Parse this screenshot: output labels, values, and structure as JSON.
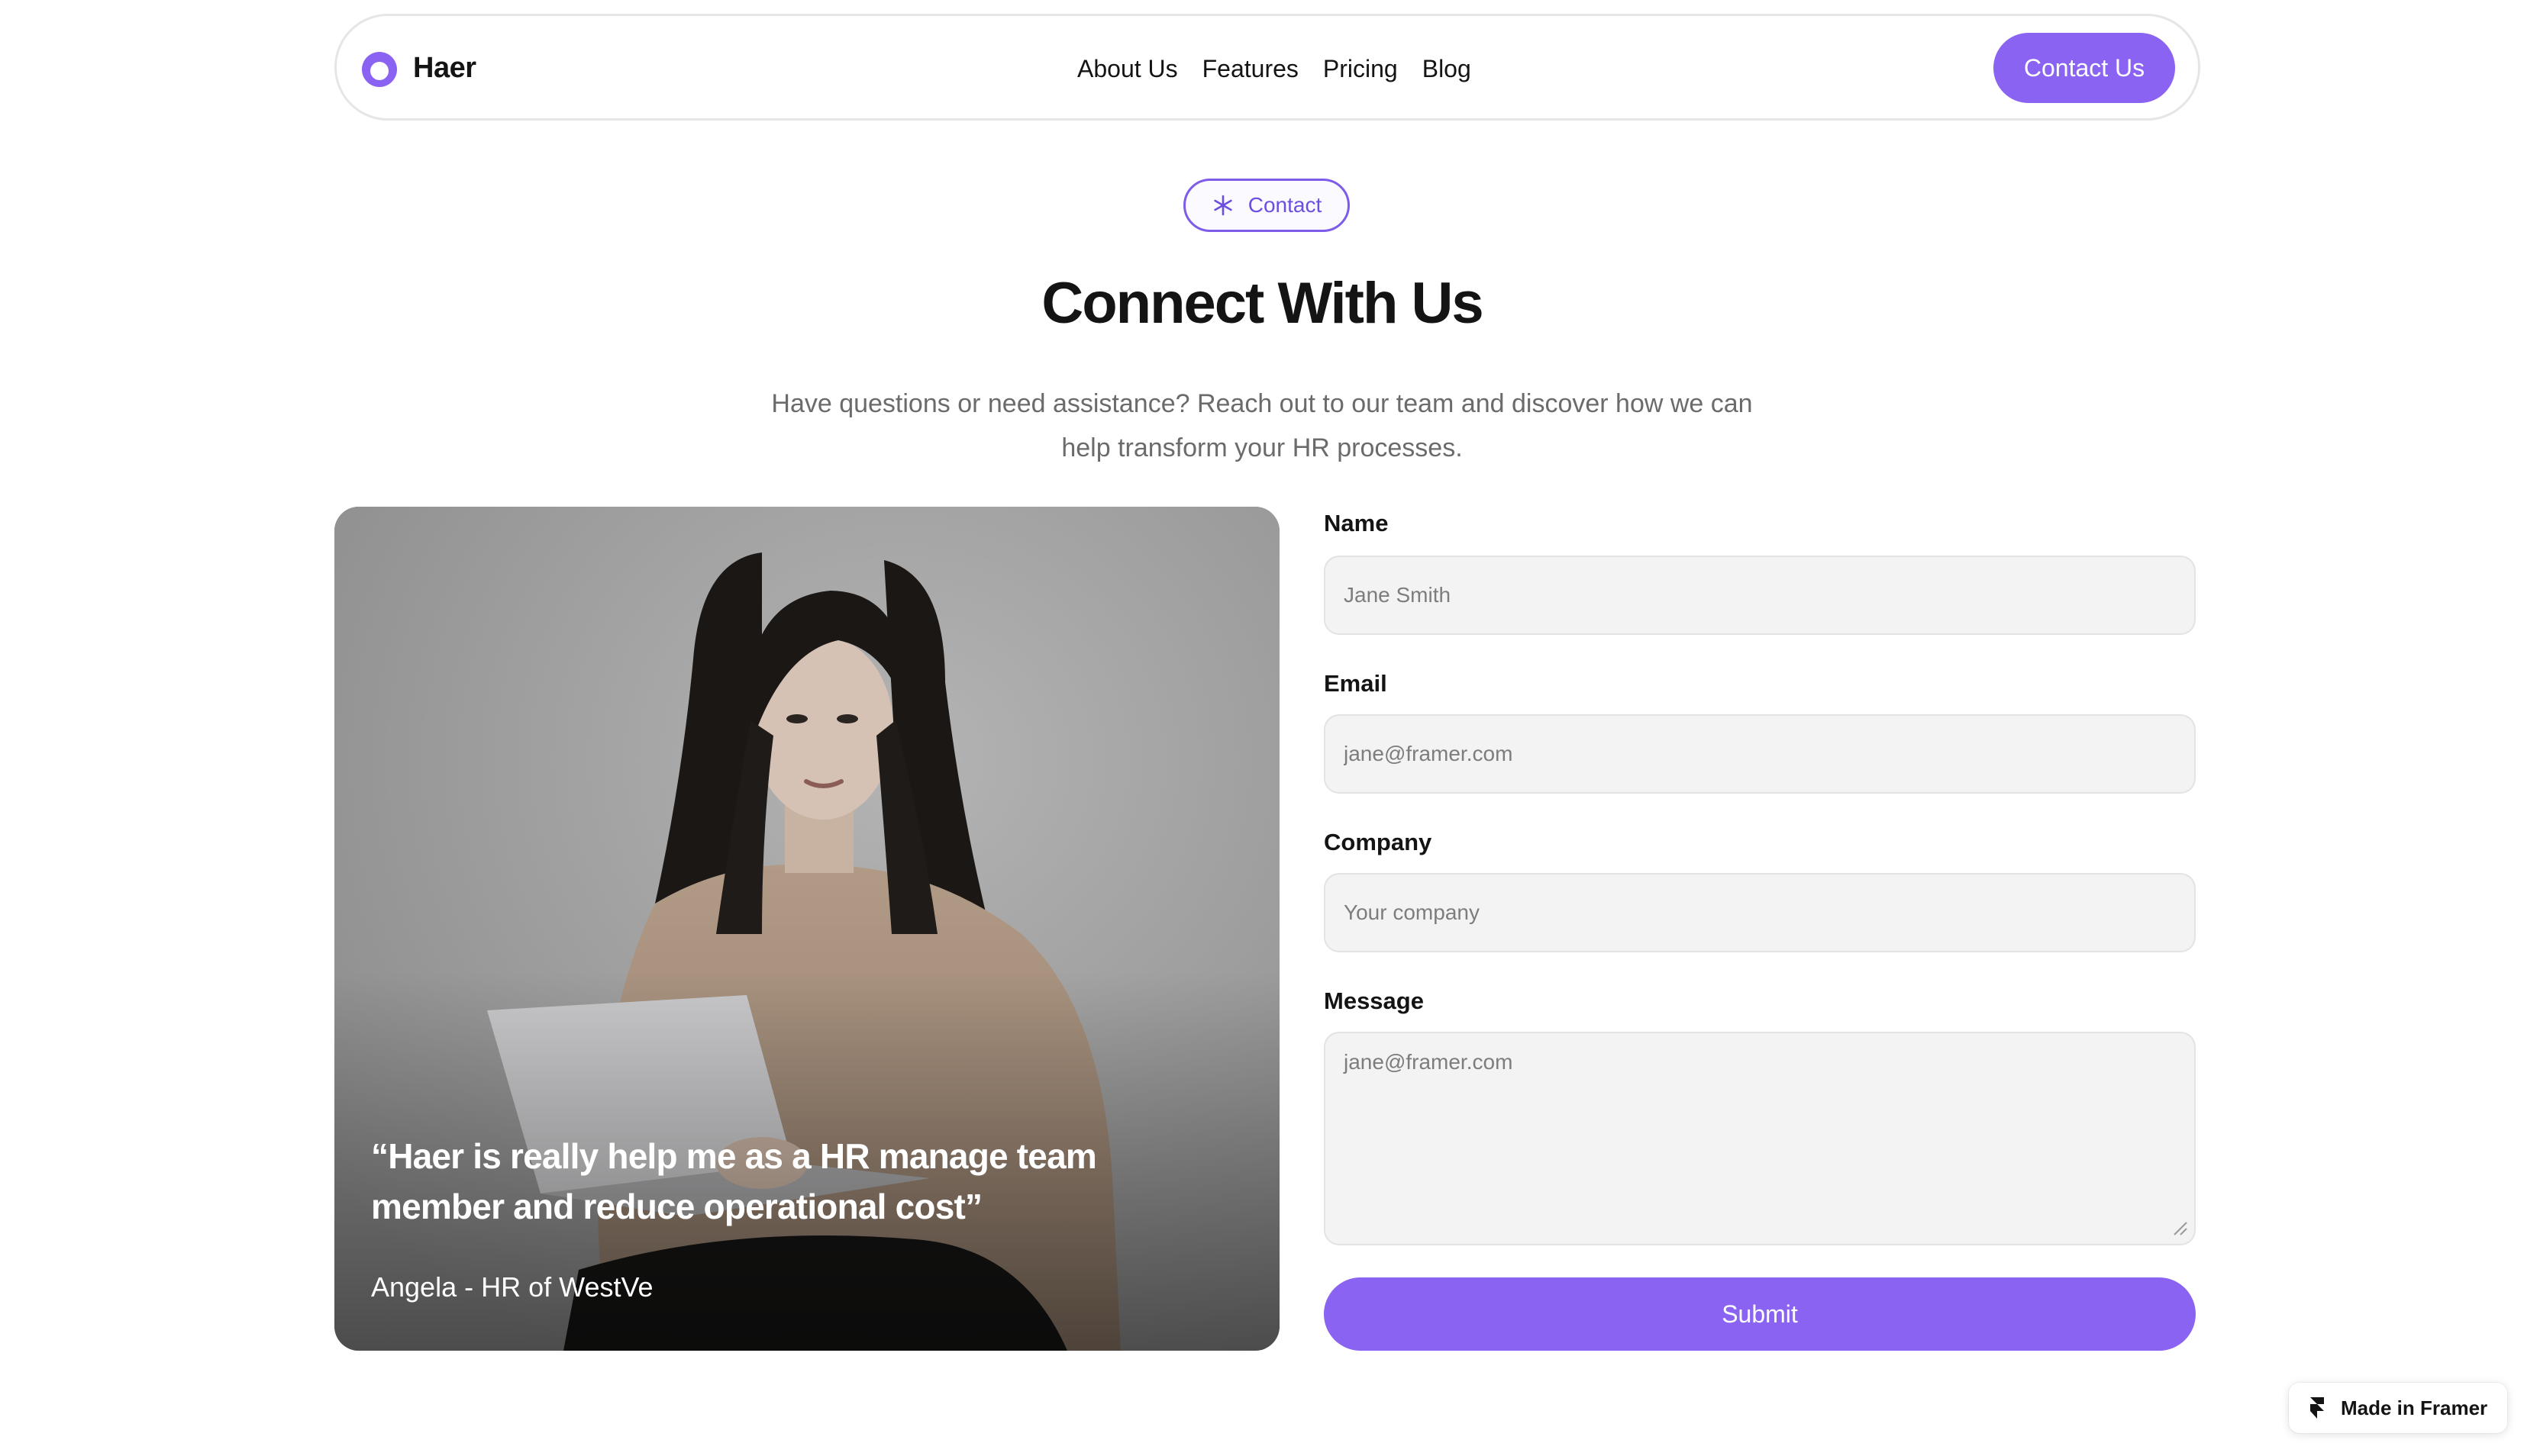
{
  "colors": {
    "accent": "#8b63f2",
    "badge_text": "#6d4fe0",
    "text": "#141414",
    "muted": "#6b6b6b",
    "input_bg": "#f3f3f3"
  },
  "nav": {
    "brand": "Haer",
    "brand_icon": "haer-logo-icon",
    "links": [
      "About Us",
      "Features",
      "Pricing",
      "Blog"
    ],
    "cta": "Contact Us"
  },
  "hero": {
    "badge_icon": "asterisk-icon",
    "badge": "Contact",
    "title": "Connect With Us",
    "subtitle": "Have questions or need assistance? Reach out to our team and discover how we can help transform your HR processes."
  },
  "testimonial": {
    "quote": "“Haer is really help me as a HR manage team member and reduce operational cost”",
    "author": "Angela - HR of WestVe"
  },
  "form": {
    "name_label": "Name",
    "name_placeholder": "Jane Smith",
    "email_label": "Email",
    "email_placeholder": "jane@framer.com",
    "company_label": "Company",
    "company_placeholder": "Your company",
    "message_label": "Message",
    "message_placeholder": "jane@framer.com",
    "submit": "Submit"
  },
  "footer_badge": {
    "icon": "framer-icon",
    "text": "Made in Framer"
  }
}
